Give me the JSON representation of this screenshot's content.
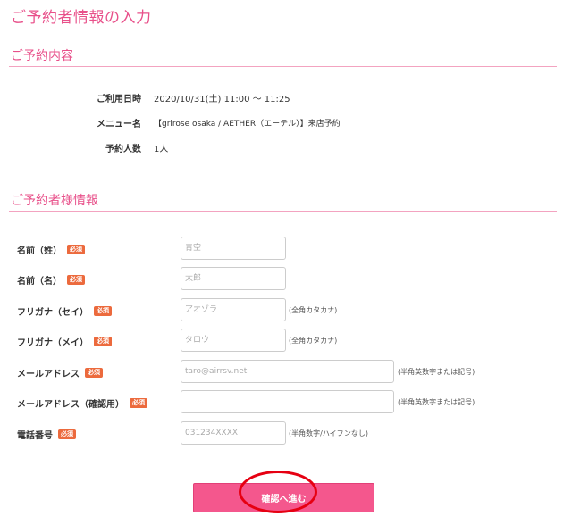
{
  "page_title": "ご予約者情報の入力",
  "reservation": {
    "title": "ご予約内容",
    "rows": [
      {
        "label": "ご利用日時",
        "value": "2020/10/31(土) 11:00 ～ 11:25"
      },
      {
        "label": "メニュー名",
        "value": "【grirose osaka / AETHER（エーテル）】来店予約"
      },
      {
        "label": "予約人数",
        "value": "1人"
      }
    ]
  },
  "customer": {
    "title": "ご予約者様情報",
    "required_badge": "必須",
    "fields": [
      {
        "label": "名前（姓）",
        "placeholder": "青空",
        "value": "",
        "hint": ""
      },
      {
        "label": "名前（名）",
        "placeholder": "太郎",
        "value": "",
        "hint": ""
      },
      {
        "label": "フリガナ（セイ）",
        "placeholder": "アオゾラ",
        "value": "",
        "hint": "(全角カタカナ)"
      },
      {
        "label": "フリガナ（メイ）",
        "placeholder": "タロウ",
        "value": "",
        "hint": "(全角カタカナ)"
      },
      {
        "label": "メールアドレス",
        "placeholder": "taro@airrsv.net",
        "value": "",
        "hint": "(半角英数字または記号)"
      },
      {
        "label": "メールアドレス（確認用）",
        "placeholder": "",
        "value": "",
        "hint": "(半角英数字または記号)"
      },
      {
        "label": "電話番号",
        "placeholder": "031234XXXX",
        "value": "",
        "hint": "(半角数字/ハイフンなし)"
      }
    ]
  },
  "submit_label": "確認へ進む",
  "colors": {
    "accent": "#e8508a",
    "button": "#f4578d",
    "badge": "#ec6a3d",
    "annotation": "#e60012"
  }
}
